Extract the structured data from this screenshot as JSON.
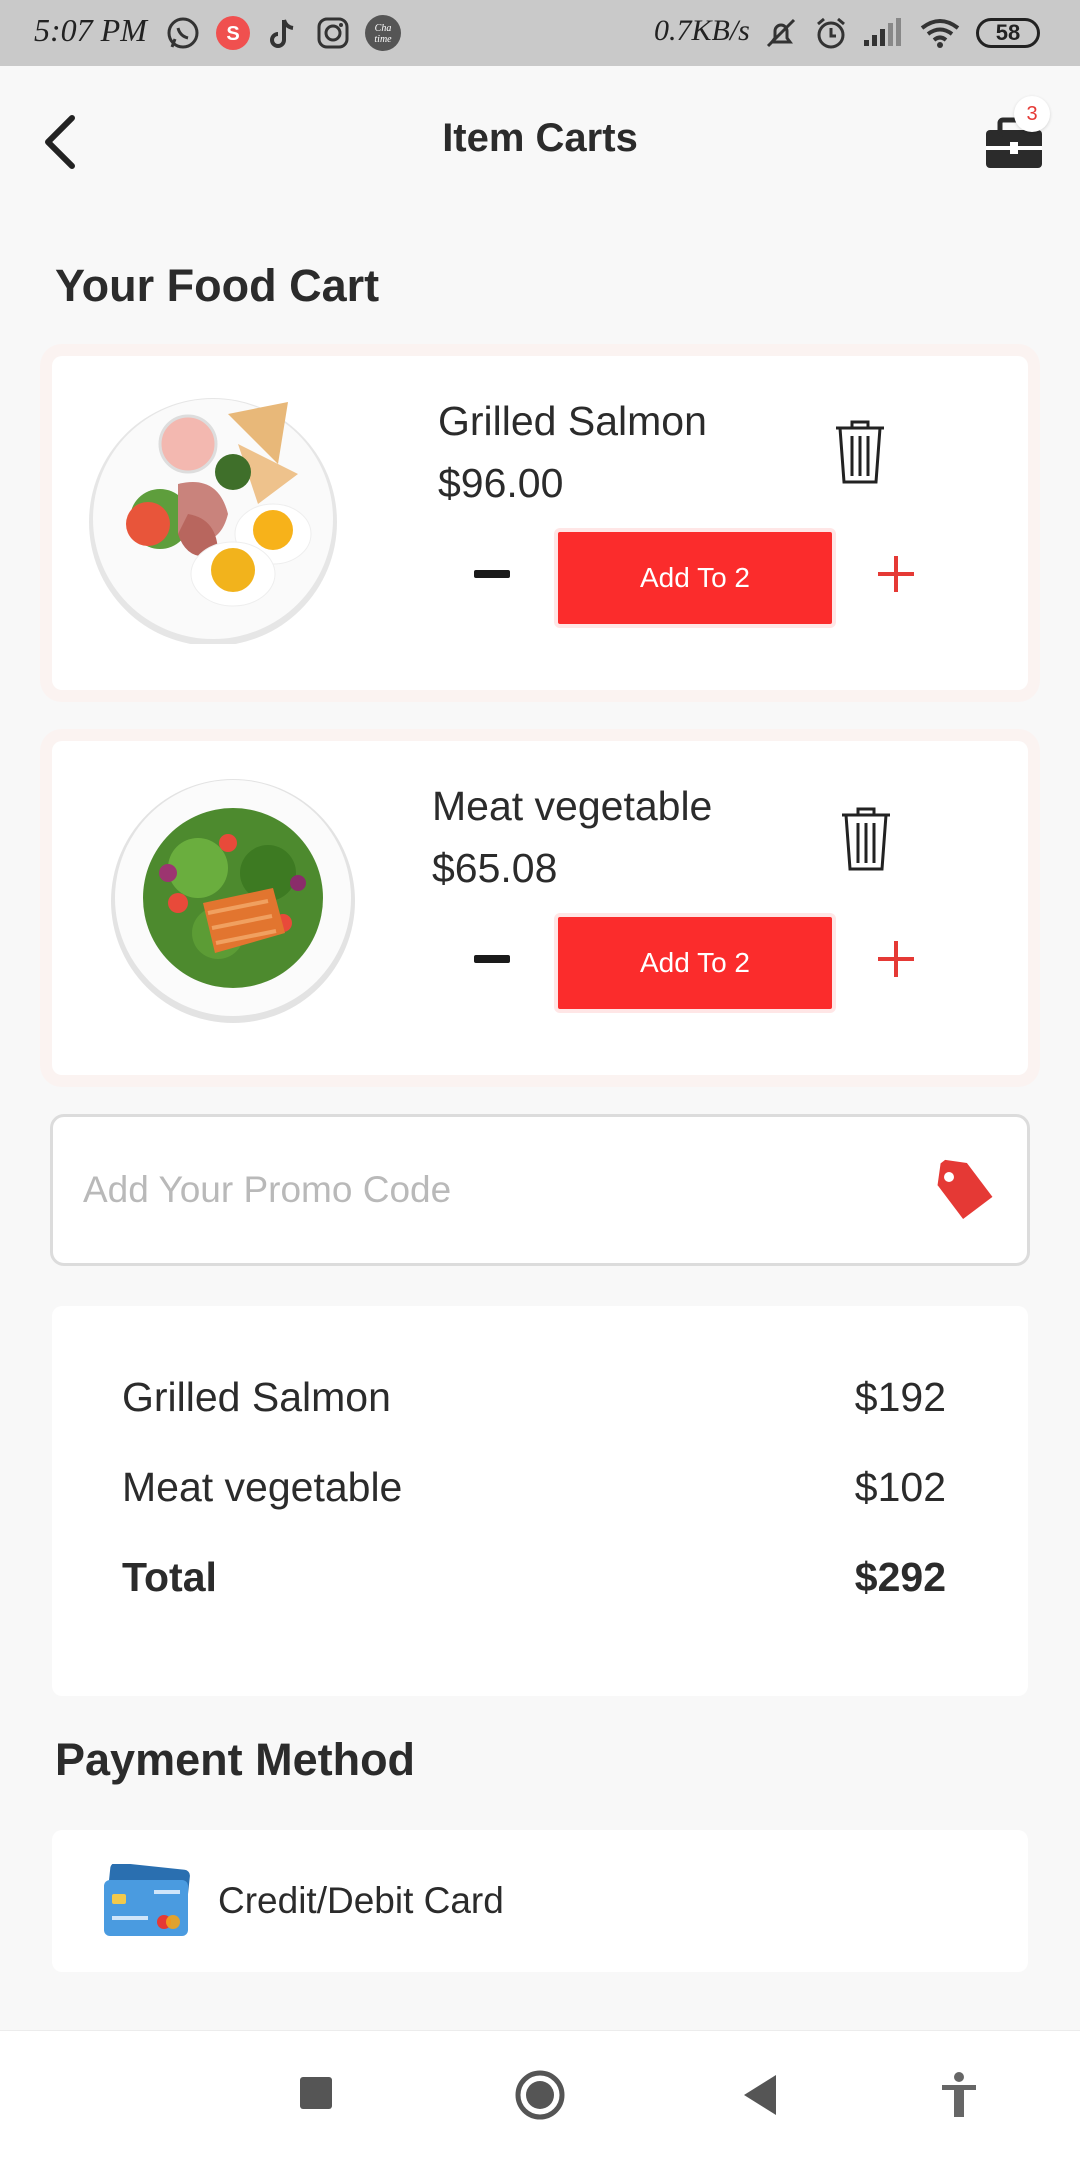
{
  "status_bar": {
    "time": "5:07 PM",
    "network_speed": "0.7KB/s",
    "battery": "58",
    "app_icons": [
      "whatsapp-icon",
      "s-app-icon",
      "tiktok-icon",
      "instagram-icon",
      "chatime-icon"
    ],
    "system_icons": [
      "mute-icon",
      "alarm-icon",
      "signal-icon",
      "wifi-icon"
    ]
  },
  "header": {
    "title": "Item Carts",
    "cart_count": "3"
  },
  "cart_section": {
    "title": "Your Food Cart",
    "items": [
      {
        "name": "Grilled Salmon",
        "price": "$96.00",
        "button_label": "Add To 2",
        "image": "breakfast-plate"
      },
      {
        "name": "Meat vegetable",
        "price": "$65.08",
        "button_label": "Add To 2",
        "image": "salmon-salad-plate"
      }
    ]
  },
  "promo": {
    "placeholder": "Add Your Promo Code"
  },
  "summary": {
    "rows": [
      {
        "label": "Grilled Salmon",
        "value": "$192"
      },
      {
        "label": "Meat vegetable",
        "value": "$102"
      }
    ],
    "total_label": "Total",
    "total_value": "$292"
  },
  "payment": {
    "title": "Payment Method",
    "method_label": "Credit/Debit Card"
  },
  "colors": {
    "accent": "#fb2c2c",
    "background": "#f8f8f8",
    "text": "#2b2b2b"
  }
}
